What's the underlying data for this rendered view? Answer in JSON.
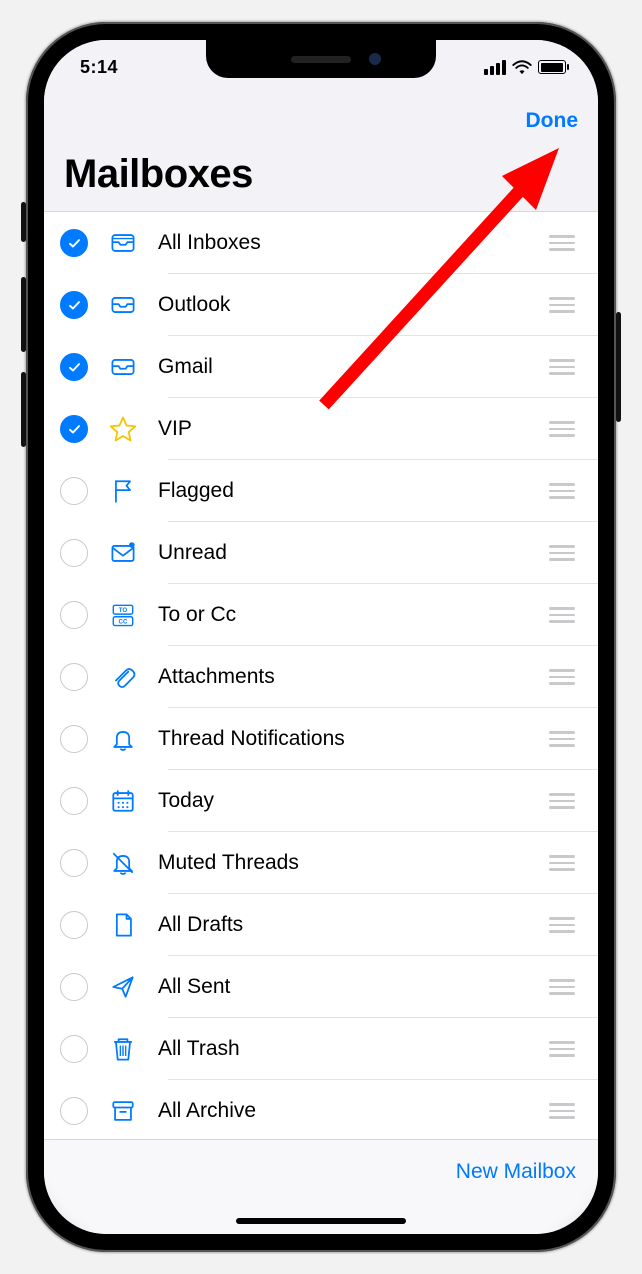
{
  "status": {
    "time": "5:14"
  },
  "nav": {
    "done_label": "Done",
    "title": "Mailboxes"
  },
  "mailboxes": [
    {
      "label": "All Inboxes",
      "checked": true,
      "icon": "all-inboxes-icon",
      "color": "#007aff",
      "data_name": "mailbox-all-inboxes"
    },
    {
      "label": "Outlook",
      "checked": true,
      "icon": "inbox-icon",
      "color": "#007aff",
      "data_name": "mailbox-outlook"
    },
    {
      "label": "Gmail",
      "checked": true,
      "icon": "inbox-icon",
      "color": "#007aff",
      "data_name": "mailbox-gmail"
    },
    {
      "label": "VIP",
      "checked": true,
      "icon": "star-icon",
      "color": "#f5c300",
      "data_name": "mailbox-vip"
    },
    {
      "label": "Flagged",
      "checked": false,
      "icon": "flag-icon",
      "color": "#007aff",
      "data_name": "mailbox-flagged"
    },
    {
      "label": "Unread",
      "checked": false,
      "icon": "unread-icon",
      "color": "#007aff",
      "data_name": "mailbox-unread"
    },
    {
      "label": "To or Cc",
      "checked": false,
      "icon": "to-cc-icon",
      "color": "#007aff",
      "data_name": "mailbox-to-cc"
    },
    {
      "label": "Attachments",
      "checked": false,
      "icon": "paperclip-icon",
      "color": "#007aff",
      "data_name": "mailbox-attachments"
    },
    {
      "label": "Thread Notifications",
      "checked": false,
      "icon": "bell-icon",
      "color": "#007aff",
      "data_name": "mailbox-thread-notifications"
    },
    {
      "label": "Today",
      "checked": false,
      "icon": "calendar-icon",
      "color": "#007aff",
      "data_name": "mailbox-today"
    },
    {
      "label": "Muted Threads",
      "checked": false,
      "icon": "bell-off-icon",
      "color": "#007aff",
      "data_name": "mailbox-muted-threads"
    },
    {
      "label": "All Drafts",
      "checked": false,
      "icon": "draft-icon",
      "color": "#007aff",
      "data_name": "mailbox-all-drafts"
    },
    {
      "label": "All Sent",
      "checked": false,
      "icon": "sent-icon",
      "color": "#007aff",
      "data_name": "mailbox-all-sent"
    },
    {
      "label": "All Trash",
      "checked": false,
      "icon": "trash-icon",
      "color": "#007aff",
      "data_name": "mailbox-all-trash"
    },
    {
      "label": "All Archive",
      "checked": false,
      "icon": "archive-icon",
      "color": "#007aff",
      "data_name": "mailbox-all-archive"
    }
  ],
  "bottom": {
    "new_mailbox_label": "New Mailbox"
  },
  "annotation": {
    "type": "arrow",
    "color": "#ff0000",
    "target": "done-button"
  }
}
